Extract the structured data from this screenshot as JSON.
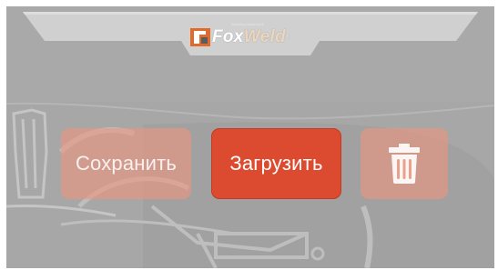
{
  "header": {
    "logo": {
      "tagline": "Welding Machines",
      "brand_part1": "Fox",
      "brand_part2": "Weld",
      "registered_mark": "®"
    }
  },
  "actions": {
    "save_label": "Сохранить",
    "load_label": "Загрузить",
    "delete_icon": "trash-icon"
  },
  "colors": {
    "panel_background": "#a6a7a6",
    "header_plate": "#cfd0cf",
    "primary_button": "#dc4a2f",
    "disabled_button": "#ec9680",
    "logo_accent": "#e06a2c"
  }
}
